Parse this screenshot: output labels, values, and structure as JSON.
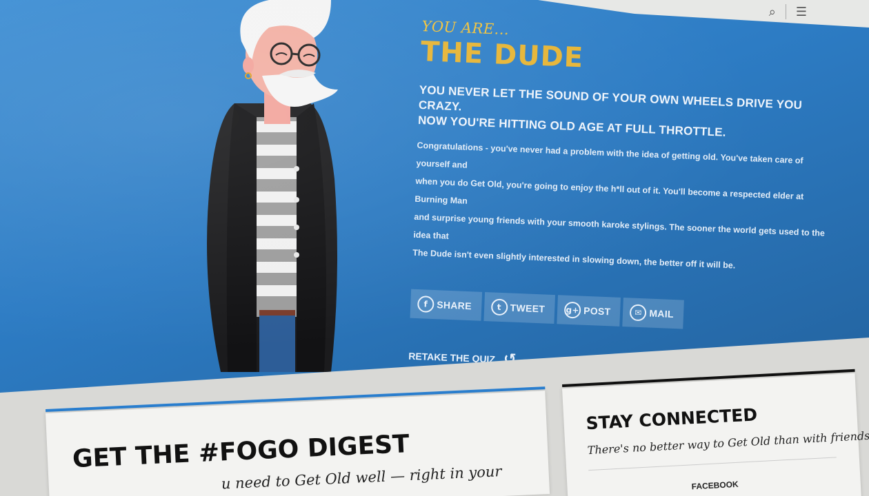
{
  "header": {
    "search_icon": "search-icon",
    "menu_icon": "menu-icon"
  },
  "result": {
    "intro": "YOU ARE...",
    "title": "THE DUDE",
    "headline_lines": [
      "YOU NEVER LET THE SOUND OF YOUR OWN WHEELS DRIVE YOU CRAZY.",
      "NOW YOU'RE HITTING OLD AGE AT FULL THROTTLE."
    ],
    "body_lines": [
      "Congratulations - you've never had a problem with the idea of getting old. You've taken care of yourself and",
      "when you do Get Old, you're going to enjoy the h*ll out of it. You'll become a respected elder at Burning Man",
      "and surprise young friends with your smooth karoke stylings. The sooner the world gets used to the idea that",
      "The Dude isn't even slightly interested in slowing down, the better off it will be."
    ]
  },
  "share": {
    "facebook": {
      "label": "SHARE",
      "glyph": "f"
    },
    "twitter": {
      "label": "TWEET",
      "glyph": "t"
    },
    "googleplus": {
      "label": "POST",
      "glyph": "g+"
    },
    "email": {
      "label": "MAIL",
      "glyph": "✉"
    }
  },
  "retake": {
    "label": "RETAKE THE QUIZ",
    "glyph": "↺"
  },
  "digest": {
    "title": "GET THE #FOGO DIGEST",
    "desc_partial": "u need to Get Old well — right in your"
  },
  "connect": {
    "title": "STAY CONNECTED",
    "desc": "There's no better way to Get Old than with friends.",
    "facebook_label": "FACEBOOK"
  },
  "colors": {
    "hero_blue": "#2d7cc4",
    "title_gold": "#e6b536",
    "accent_blue_rule": "#2a7fd0"
  }
}
